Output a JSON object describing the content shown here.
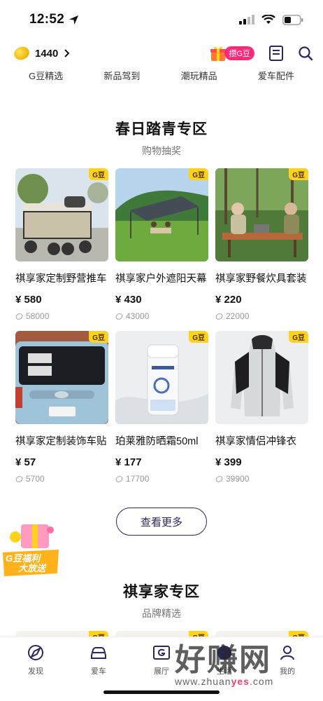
{
  "status_bar": {
    "time": "12:52"
  },
  "header": {
    "bean_count": "1440",
    "earn_label": "攒G豆"
  },
  "tabs": [
    "G豆精选",
    "新品驾到",
    "潮玩精品",
    "爱车配件"
  ],
  "section1": {
    "title": "春日踏青专区",
    "subtitle": "购物抽奖"
  },
  "products": [
    {
      "name": "祺享家定制野营推车",
      "price": "¥ 580",
      "sold": "58000",
      "tag": "G豆",
      "image": "camping-cart"
    },
    {
      "name": "祺享家户外遮阳天幕",
      "price": "¥ 430",
      "sold": "43000",
      "tag": "G豆",
      "image": "canopy-tent"
    },
    {
      "name": "祺享家野餐炊具套装",
      "price": "¥ 220",
      "sold": "22000",
      "tag": "G豆",
      "image": "picnic-cookware"
    },
    {
      "name": "祺享家定制装饰车贴",
      "price": "¥ 57",
      "sold": "5700",
      "tag": "G豆",
      "image": "car-sticker"
    },
    {
      "name": "珀莱雅防晒霜50ml",
      "price": "¥ 177",
      "sold": "17700",
      "tag": "G豆",
      "image": "sunscreen"
    },
    {
      "name": "祺享家情侣冲锋衣",
      "price": "¥ 399",
      "sold": "39900",
      "tag": "G豆",
      "image": "jacket"
    }
  ],
  "see_more_label": "查看更多",
  "promo": {
    "line1": "G豆福利",
    "line2": "大放送"
  },
  "section2": {
    "title": "祺享家专区",
    "subtitle": "品牌精选",
    "tag": "G豆"
  },
  "bottom_nav": [
    {
      "label": "发现",
      "icon": "discover-icon"
    },
    {
      "label": "爱车",
      "icon": "car-icon"
    },
    {
      "label": "展厅",
      "icon": "showroom-icon"
    },
    {
      "label": "生活",
      "icon": "life-icon"
    },
    {
      "label": "我的",
      "icon": "profile-icon"
    }
  ],
  "watermark": {
    "cn": "好赚网",
    "url_prefix": "www.zhuan",
    "url_accent": "yes",
    "url_suffix": ".com"
  },
  "colors": {
    "accent": "#2b2766",
    "badge": "#ff2b7a",
    "tag": "#ffd21c"
  }
}
